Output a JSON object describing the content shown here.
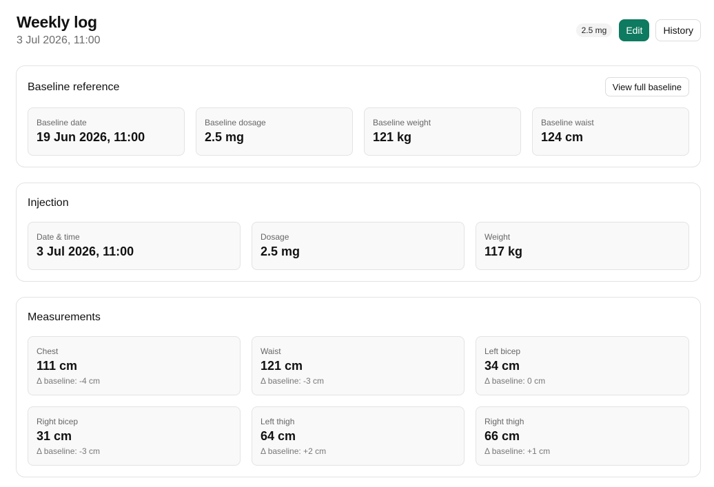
{
  "header": {
    "title": "Weekly log",
    "subtitle": "3 Jul 2026, 11:00",
    "dose_badge": "2.5 mg",
    "edit_label": "Edit",
    "history_label": "History"
  },
  "baseline": {
    "title": "Baseline reference",
    "view_button": "View full baseline",
    "tiles": [
      {
        "label": "Baseline date",
        "value": "19 Jun 2026, 11:00"
      },
      {
        "label": "Baseline dosage",
        "value": "2.5 mg"
      },
      {
        "label": "Baseline weight",
        "value": "121 kg"
      },
      {
        "label": "Baseline waist",
        "value": "124 cm"
      }
    ]
  },
  "injection": {
    "title": "Injection",
    "tiles": [
      {
        "label": "Date & time",
        "value": "3 Jul 2026, 11:00"
      },
      {
        "label": "Dosage",
        "value": "2.5 mg"
      },
      {
        "label": "Weight",
        "value": "117 kg"
      }
    ]
  },
  "measurements": {
    "title": "Measurements",
    "tiles": [
      {
        "label": "Chest",
        "value": "111 cm",
        "delta": "Δ baseline: -4 cm"
      },
      {
        "label": "Waist",
        "value": "121 cm",
        "delta": "Δ baseline: -3 cm"
      },
      {
        "label": "Left bicep",
        "value": "34 cm",
        "delta": "Δ baseline: 0 cm"
      },
      {
        "label": "Right bicep",
        "value": "31 cm",
        "delta": "Δ baseline: -3 cm"
      },
      {
        "label": "Left thigh",
        "value": "64 cm",
        "delta": "Δ baseline: +2 cm"
      },
      {
        "label": "Right thigh",
        "value": "66 cm",
        "delta": "Δ baseline: +1 cm"
      }
    ]
  },
  "colors": {
    "accent": "#0e7a5f",
    "tile_bg": "#f8f9f8",
    "border": "#e3e3e3"
  }
}
